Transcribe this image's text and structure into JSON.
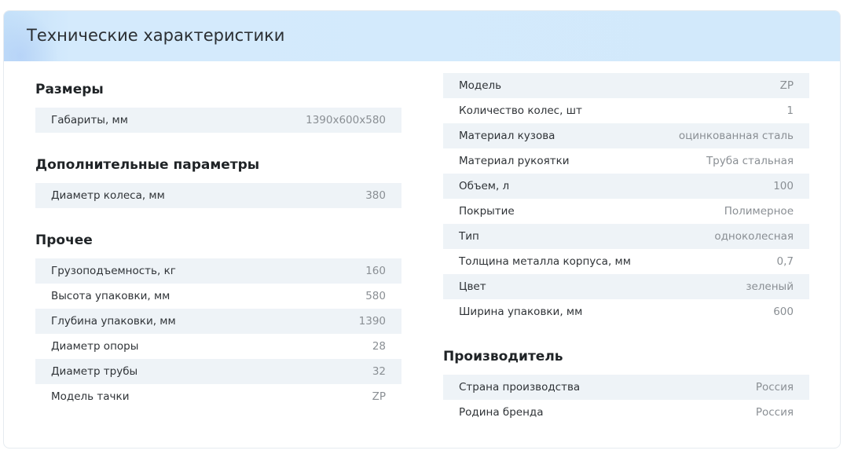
{
  "header": {
    "title": "Технические характеристики"
  },
  "left": {
    "sections": [
      {
        "title": "Размеры",
        "rows": [
          {
            "label": "Габариты, мм",
            "value": "1390x600x580"
          }
        ]
      },
      {
        "title": "Дополнительные параметры",
        "rows": [
          {
            "label": "Диаметр колеса, мм",
            "value": "380"
          }
        ]
      },
      {
        "title": "Прочее",
        "rows": [
          {
            "label": "Грузоподъемность, кг",
            "value": "160"
          },
          {
            "label": "Высота упаковки, мм",
            "value": "580"
          },
          {
            "label": "Глубина упаковки, мм",
            "value": "1390"
          },
          {
            "label": "Диаметр опоры",
            "value": "28"
          },
          {
            "label": "Диаметр трубы",
            "value": "32"
          },
          {
            "label": "Модель тачки",
            "value": "ZP"
          }
        ]
      }
    ]
  },
  "right": {
    "main_rows": [
      {
        "label": "Модель",
        "value": "ZP"
      },
      {
        "label": "Количество колес, шт",
        "value": "1"
      },
      {
        "label": "Материал кузова",
        "value": "оцинкованная сталь"
      },
      {
        "label": "Материал рукоятки",
        "value": "Труба стальная"
      },
      {
        "label": "Объем, л",
        "value": "100"
      },
      {
        "label": "Покрытие",
        "value": "Полимерное"
      },
      {
        "label": "Тип",
        "value": "одноколесная"
      },
      {
        "label": "Толщина металла корпуса, мм",
        "value": "0,7"
      },
      {
        "label": "Цвет",
        "value": "зеленый"
      },
      {
        "label": "Ширина упаковки, мм",
        "value": "600"
      }
    ],
    "manufacturer": {
      "title": "Производитель",
      "rows": [
        {
          "label": "Страна производства",
          "value": "Россия"
        },
        {
          "label": "Родина бренда",
          "value": "Россия"
        }
      ]
    }
  }
}
